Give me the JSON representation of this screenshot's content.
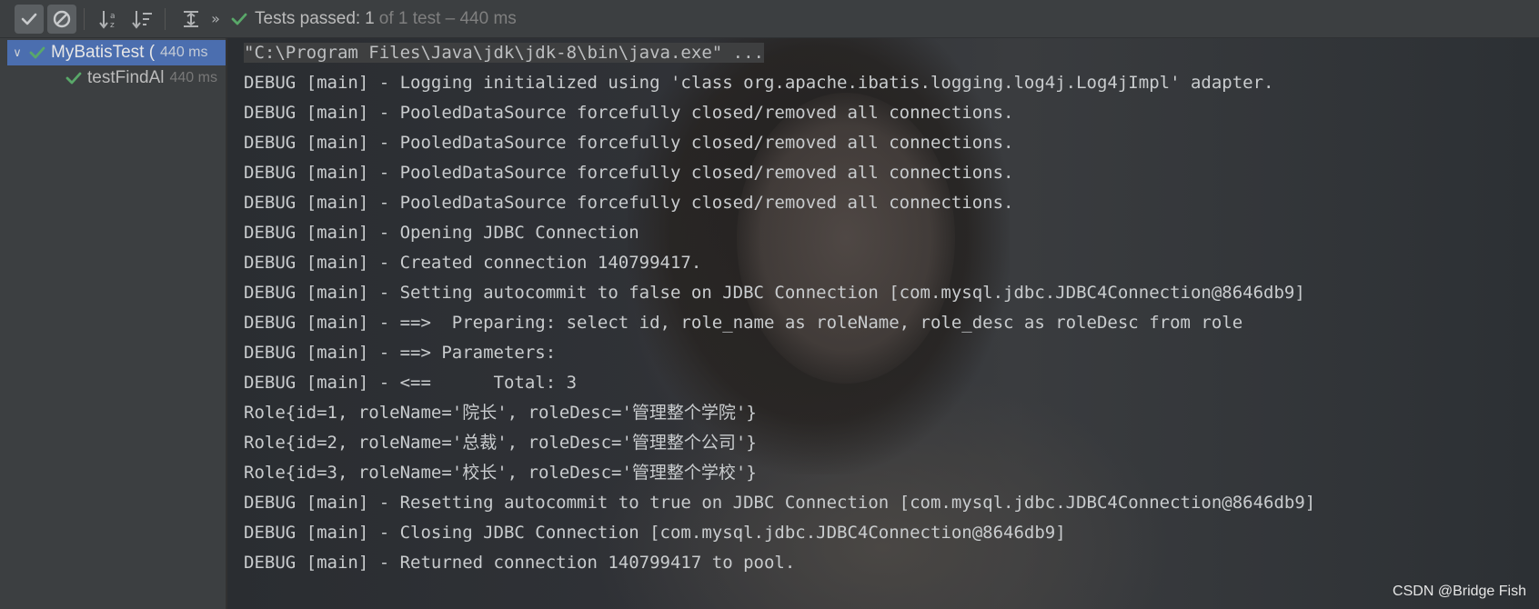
{
  "toolbar": {
    "buttons": [
      {
        "icon": "check-icon",
        "active": true
      },
      {
        "icon": "stop-icon",
        "active": true
      },
      {
        "icon": "sort-alpha-icon",
        "active": false
      },
      {
        "icon": "sort-duration-icon",
        "active": false
      },
      {
        "icon": "expand-collapse-icon",
        "active": false
      }
    ],
    "more": "»"
  },
  "status": {
    "label": "Tests passed:",
    "count": "1",
    "rest": "of 1 test – 440 ms",
    "color": "#59a869"
  },
  "tree": {
    "root": {
      "name": "MyBatisTest (",
      "time": "440 ms"
    },
    "child": {
      "name": "testFindAl",
      "time": "440 ms"
    }
  },
  "console": {
    "command": "\"C:\\Program Files\\Java\\jdk\\jdk-8\\bin\\java.exe\" ...",
    "lines": [
      "DEBUG [main] - Logging initialized using 'class org.apache.ibatis.logging.log4j.Log4jImpl' adapter.",
      "DEBUG [main] - PooledDataSource forcefully closed/removed all connections.",
      "DEBUG [main] - PooledDataSource forcefully closed/removed all connections.",
      "DEBUG [main] - PooledDataSource forcefully closed/removed all connections.",
      "DEBUG [main] - PooledDataSource forcefully closed/removed all connections.",
      "DEBUG [main] - Opening JDBC Connection",
      "DEBUG [main] - Created connection 140799417.",
      "DEBUG [main] - Setting autocommit to false on JDBC Connection [com.mysql.jdbc.JDBC4Connection@8646db9]",
      "DEBUG [main] - ==>  Preparing: select id, role_name as roleName, role_desc as roleDesc from role",
      "DEBUG [main] - ==> Parameters: ",
      "DEBUG [main] - <==      Total: 3",
      "Role{id=1, roleName='院长', roleDesc='管理整个学院'}",
      "Role{id=2, roleName='总裁', roleDesc='管理整个公司'}",
      "Role{id=3, roleName='校长', roleDesc='管理整个学校'}",
      "DEBUG [main] - Resetting autocommit to true on JDBC Connection [com.mysql.jdbc.JDBC4Connection@8646db9]",
      "DEBUG [main] - Closing JDBC Connection [com.mysql.jdbc.JDBC4Connection@8646db9]",
      "DEBUG [main] - Returned connection 140799417 to pool."
    ]
  },
  "watermark": "CSDN @Bridge Fish"
}
